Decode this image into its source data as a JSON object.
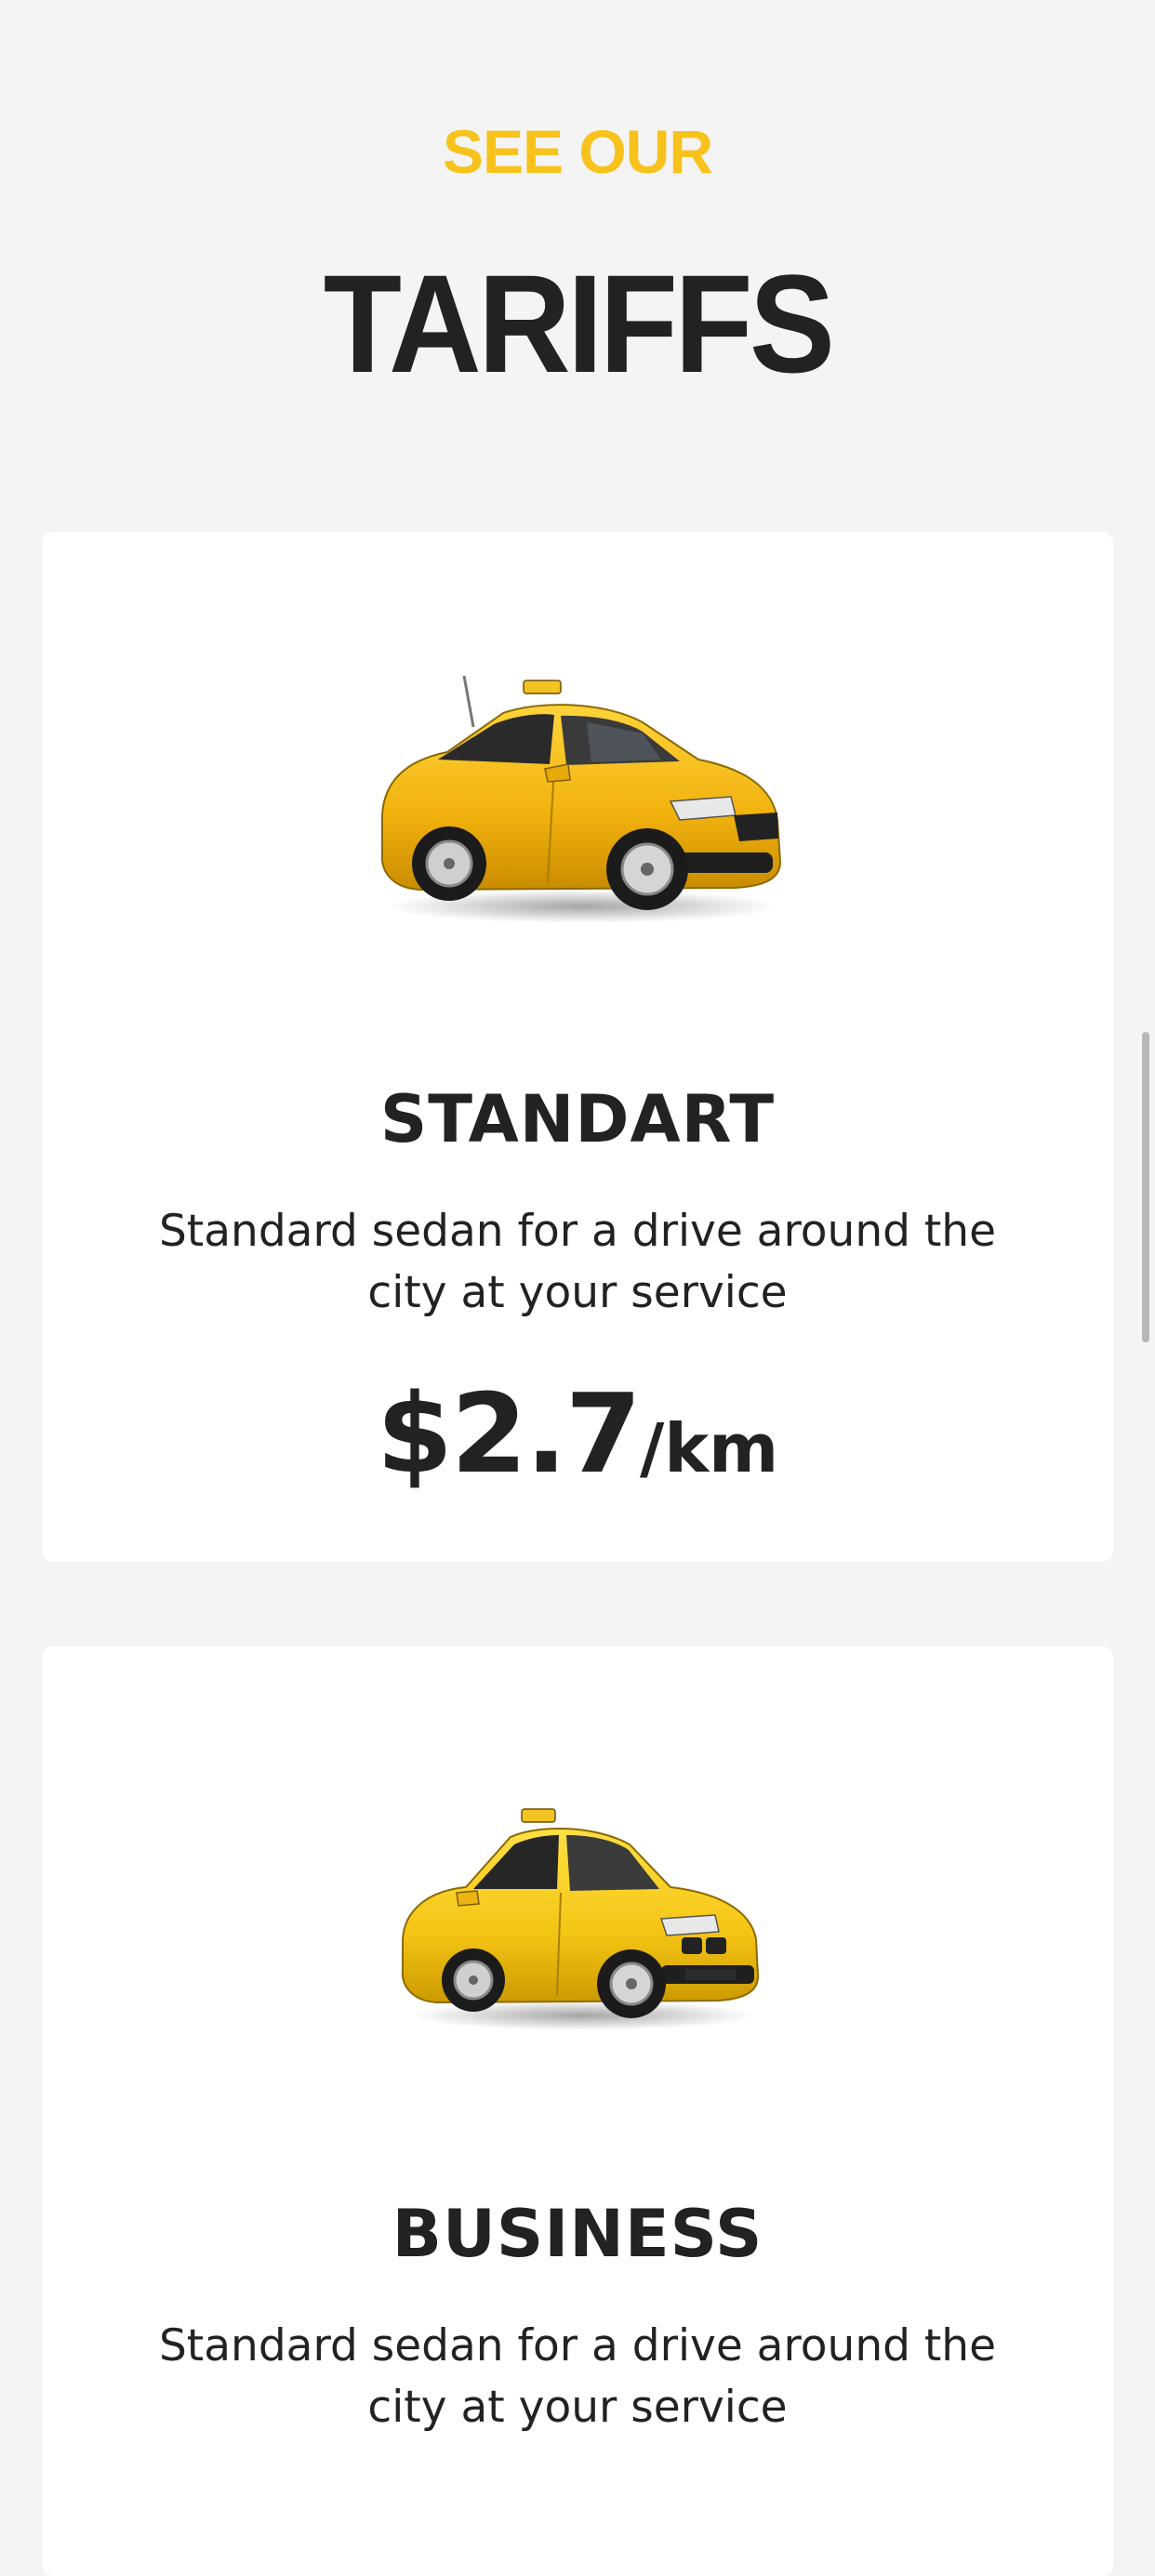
{
  "header": {
    "eyebrow": "SEE OUR",
    "title": "TARIFFS"
  },
  "tariffs": [
    {
      "name": "STANDART",
      "description": "Standard sedan for a drive around the city at your service",
      "price": "$2.7",
      "unit": "/km",
      "image_icon": "yellow-hatchback-taxi-image"
    },
    {
      "name": "BUSINESS",
      "description": "Standard sedan for a drive around the city at your service",
      "image_icon": "yellow-sedan-taxi-image"
    }
  ],
  "colors": {
    "accent": "#f7c21c",
    "text": "#222222",
    "background": "#f4f4f4",
    "card": "#ffffff"
  }
}
